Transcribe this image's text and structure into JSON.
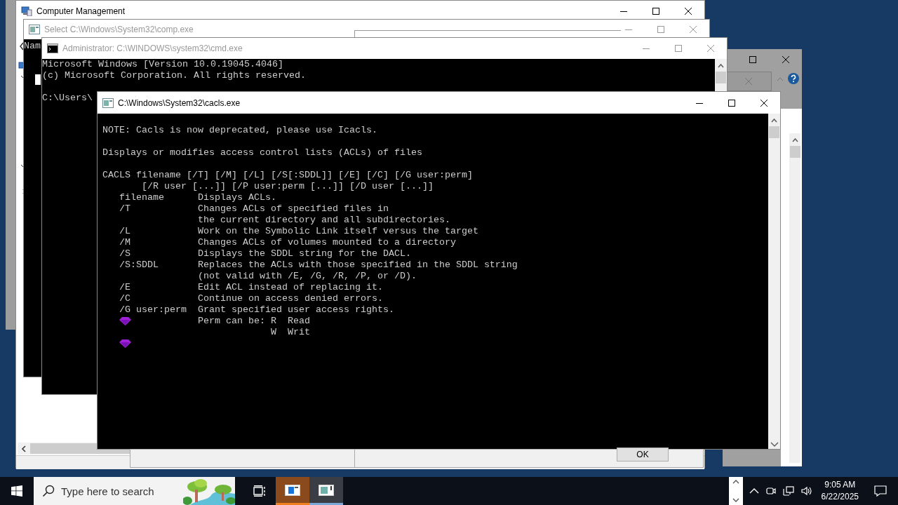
{
  "computer_management": {
    "title": "Computer Management",
    "active": true
  },
  "comp_window": {
    "title": "Select C:\\Windows\\System32\\comp.exe",
    "active": false,
    "lines": [
      "Nam"
    ]
  },
  "cmd_window": {
    "title": "Administrator: C:\\WINDOWS\\system32\\cmd.exe",
    "active": false,
    "lines": [
      {
        "kind": "text",
        "text": "Microsoft Windows [Version 10.0.19045.4046]"
      },
      {
        "kind": "text",
        "text": "(c) Microsoft Corporation. All rights reserved."
      },
      {
        "kind": "blank"
      },
      {
        "kind": "text",
        "text": "C:\\Users\\"
      }
    ]
  },
  "cacls_window": {
    "title": "C:\\Windows\\System32\\cacls.exe",
    "active": true,
    "lines": [
      {
        "kind": "text",
        "text": "NOTE: Cacls is now deprecated, please use Icacls."
      },
      {
        "kind": "blank"
      },
      {
        "kind": "text",
        "text": "Displays or modifies access control lists (ACLs) of files"
      },
      {
        "kind": "blank"
      },
      {
        "kind": "text",
        "text": "CACLS filename [/T] [/M] [/L] [/S[:SDDL]] [/E] [/C] [/G user:perm]"
      },
      {
        "kind": "text",
        "text": "       [/R user [...]] [/P user:perm [...]] [/D user [...]]"
      },
      {
        "kind": "text",
        "text": "   filename      Displays ACLs."
      },
      {
        "kind": "text",
        "text": "   /T            Changes ACLs of specified files in"
      },
      {
        "kind": "text",
        "text": "                 the current directory and all subdirectories."
      },
      {
        "kind": "text",
        "text": "   /L            Work on the Symbolic Link itself versus the target"
      },
      {
        "kind": "text",
        "text": "   /M            Changes ACLs of volumes mounted to a directory"
      },
      {
        "kind": "text",
        "text": "   /S            Displays the SDDL string for the DACL."
      },
      {
        "kind": "text",
        "text": "   /S:SDDL       Replaces the ACLs with those specified in the SDDL string"
      },
      {
        "kind": "text",
        "text": "                 (not valid with /E, /G, /R, /P, or /D)."
      },
      {
        "kind": "text",
        "text": "   /E            Edit ACL instead of replacing it."
      },
      {
        "kind": "text",
        "text": "   /C            Continue on access denied errors."
      },
      {
        "kind": "text",
        "text": "   /G user:perm  Grant specified user access rights."
      },
      {
        "kind": "gem_text",
        "text": "Perm can be: R  Read"
      },
      {
        "kind": "text",
        "text": "                              W  Writ"
      },
      {
        "kind": "gem"
      }
    ]
  },
  "dialog": {
    "button": "OK"
  },
  "taskbar": {
    "search_placeholder": "Type here to search",
    "apps": [
      {
        "kind": "explorer",
        "selected": true
      },
      {
        "kind": "console",
        "selected": false
      }
    ],
    "time": "9:05 AM",
    "date": "6/22/2025"
  }
}
